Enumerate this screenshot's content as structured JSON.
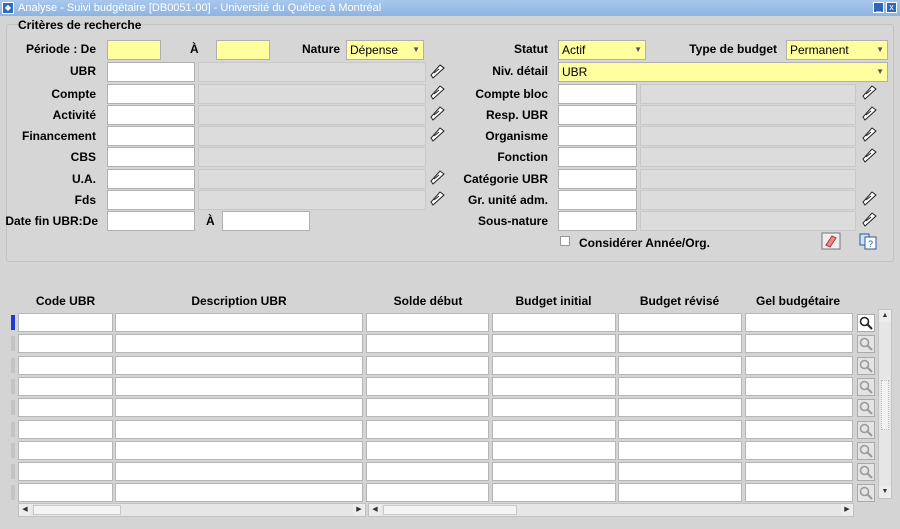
{
  "window": {
    "title": "Analyse - Suivi budgétaire [DB0051-00] - Université du Québec à Montréal",
    "minimize": "_",
    "close": "x"
  },
  "criteria": {
    "section_title": "Critères de recherche",
    "periode_label": "Période : De",
    "periode_from": "",
    "a_label": "À",
    "periode_to": "",
    "nature_label": "Nature",
    "nature_value": "Dépense",
    "statut_label": "Statut",
    "statut_value": "Actif",
    "type_budget_label": "Type de budget",
    "type_budget_value": "Permanent",
    "ubr_label": "UBR",
    "niv_detail_label": "Niv. détail",
    "niv_detail_value": "UBR",
    "compte_label": "Compte",
    "compte_bloc_label": "Compte bloc",
    "activite_label": "Activité",
    "resp_ubr_label": "Resp. UBR",
    "financement_label": "Financement",
    "organisme_label": "Organisme",
    "cbs_label": "CBS",
    "fonction_label": "Fonction",
    "ua_label": "U.A.",
    "categorie_ubr_label": "Catégorie UBR",
    "fds_label": "Fds",
    "gr_unite_label": "Gr. unité adm.",
    "date_fin_label": "Date fin UBR:De",
    "date_fin_a_label": "À",
    "sous_nature_label": "Sous-nature",
    "considerer_label": "Considérer Année/Org.",
    "considerer_checked": false
  },
  "grid": {
    "headers": [
      "Code UBR",
      "Description UBR",
      "Solde début",
      "Budget initial",
      "Budget révisé",
      "Gel budgétaire"
    ],
    "row_count": 9
  },
  "icons": {
    "lov": "lov-pencil-icon",
    "eraser": "eraser-icon",
    "help": "help-query-icon",
    "zoom": "magnifier-icon"
  },
  "colors": {
    "required_field": "#ffff9f",
    "title_bar": "#9dbfe8",
    "active_row_marker": "#1e3bd1"
  }
}
